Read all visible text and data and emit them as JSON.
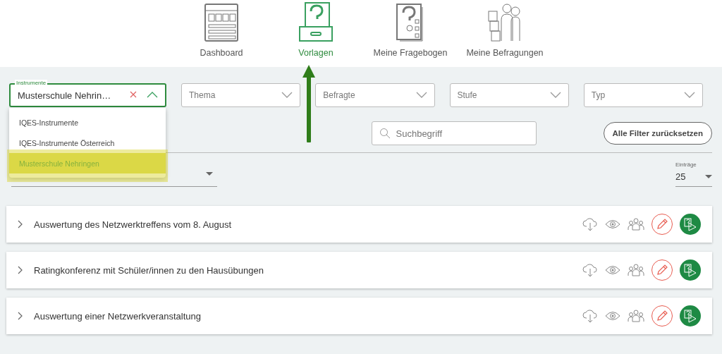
{
  "nav": [
    {
      "label": "Dashboard",
      "selected": false
    },
    {
      "label": "Vorlagen",
      "selected": true
    },
    {
      "label": "Meine Fragebogen",
      "selected": false
    },
    {
      "label": "Meine Befragungen",
      "selected": false
    }
  ],
  "filters": [
    {
      "kind": "open",
      "label": "Instrumente",
      "value": "Musterschule Nehrin…"
    },
    {
      "kind": "closed",
      "placeholder": "Thema"
    },
    {
      "kind": "closed",
      "placeholder": "Befragte"
    },
    {
      "kind": "closed",
      "placeholder": "Stufe"
    },
    {
      "kind": "closed",
      "placeholder": "Typ"
    }
  ],
  "menu": [
    {
      "label": "IQES-Instrumente",
      "selected": false
    },
    {
      "label": "IQES-Instrumente Österreich",
      "selected": false
    },
    {
      "label": "Musterschule Nehringen",
      "selected": true
    }
  ],
  "search": {
    "placeholder": "Suchbegriff"
  },
  "reset_button": "Alle Filter zurücksetzen",
  "entries": {
    "label": "Einträge",
    "value": "25"
  },
  "rows": [
    {
      "title": "Auswertung des Netzwerktreffens vom 8. August"
    },
    {
      "title": "Ratingkonferenz mit Schüler/innen zu den Hausübungen"
    },
    {
      "title": "Auswertung einer Netzwerkveranstaltung"
    }
  ]
}
